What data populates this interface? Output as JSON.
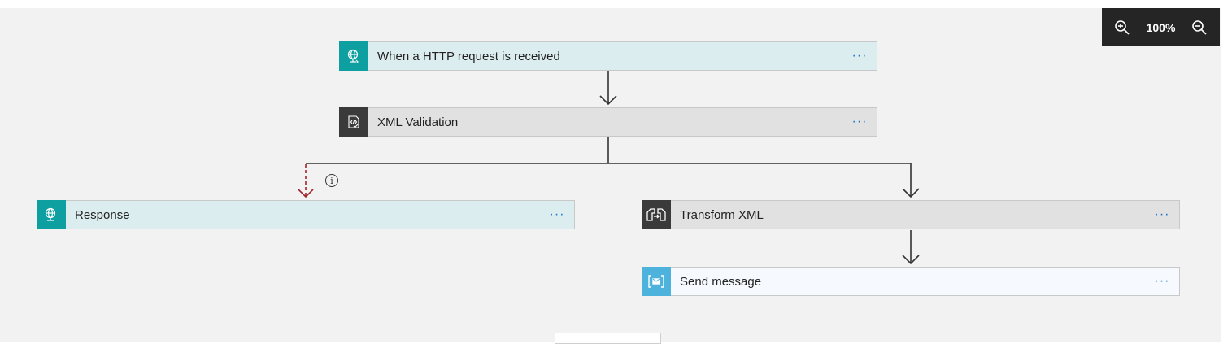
{
  "zoom": {
    "zoom_in_icon": "zoom-in-icon",
    "level": "100%",
    "zoom_out_icon": "zoom-out-icon"
  },
  "steps": {
    "trigger": {
      "title": "When a HTTP request is received",
      "icon": "http-request-icon",
      "more": "···",
      "color": "#0e9fa0"
    },
    "validation": {
      "title": "XML Validation",
      "icon": "xml-validation-icon",
      "more": "···",
      "color": "#3a3a3a"
    },
    "response": {
      "title": "Response",
      "icon": "http-response-icon",
      "more": "···",
      "color": "#0e9fa0"
    },
    "transform": {
      "title": "Transform XML",
      "icon": "transform-xml-icon",
      "more": "···",
      "color": "#3a3a3a"
    },
    "send": {
      "title": "Send message",
      "icon": "service-bus-icon",
      "more": "···",
      "color": "#4eb3dc"
    }
  },
  "info_icon": "i",
  "connector_colors": {
    "normal": "#333333",
    "failure_path": "#a4262c"
  }
}
